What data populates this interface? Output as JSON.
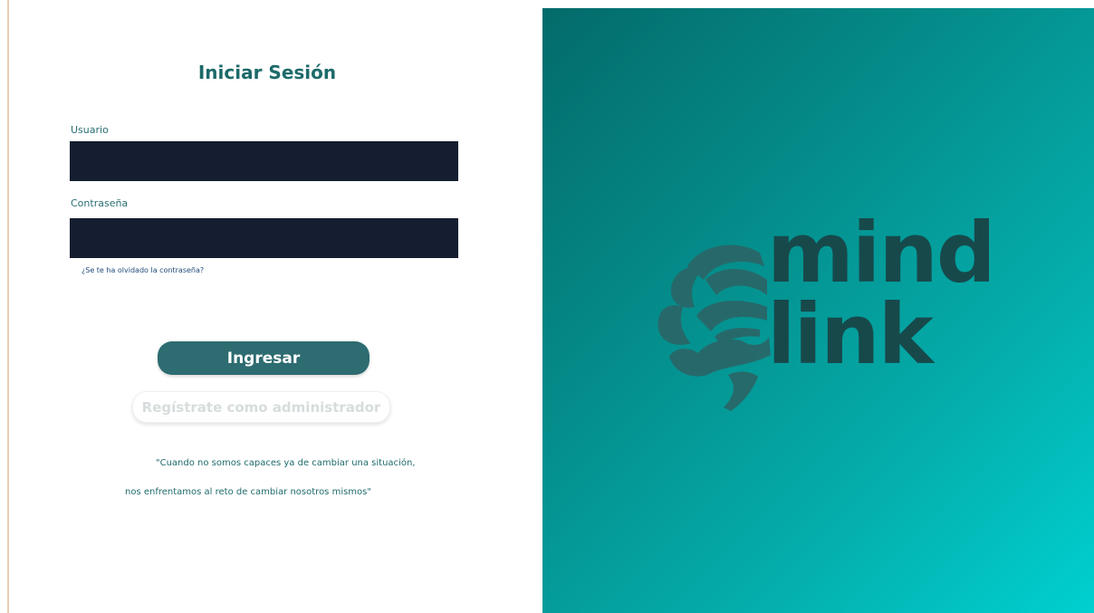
{
  "login": {
    "title": "Iniciar Sesión",
    "username_label": "Usuario",
    "username_value": "",
    "password_label": "Contraseña",
    "password_value": "",
    "forgot_password": "¿Se te ha olvidado la contraseña?",
    "submit_label": "Ingresar",
    "register_label": "Regístrate como administrador",
    "quote_line1": "\"Cuando no somos capaces ya de cambiar una situación,",
    "quote_line2": "nos enfrentamos al reto de cambiar nosotros mismos\""
  },
  "brand": {
    "word1": "mind",
    "word2": "link",
    "icon": "brain-icon",
    "gradient_start": "#036b6a",
    "gradient_end": "#00d0d0",
    "logo_color": "#17494b"
  },
  "colors": {
    "title": "#1d6a6a",
    "input_bg": "#141e30",
    "primary_button": "#2d6c70"
  }
}
